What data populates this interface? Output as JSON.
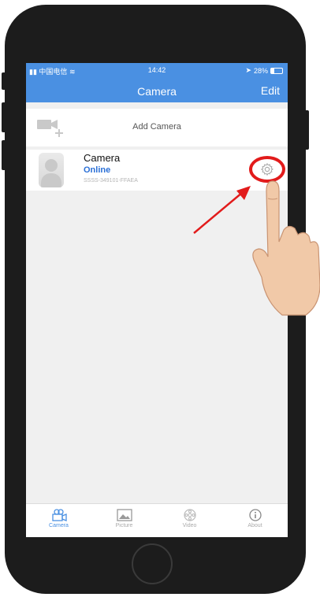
{
  "status_bar": {
    "carrier": "中国电信",
    "time": "14:42",
    "battery_text": "28%",
    "battery_level": 0.28
  },
  "navbar": {
    "title": "Camera",
    "edit_label": "Edit"
  },
  "add_camera": {
    "label": "Add Camera",
    "icon": "camera-add-icon"
  },
  "camera_item": {
    "name": "Camera",
    "status": "Online",
    "id": "SSSS-349101-FFAEA",
    "settings_icon": "gear-icon"
  },
  "tabs": [
    {
      "label": "Camera",
      "icon": "camera-tab-icon",
      "active": true
    },
    {
      "label": "Picture",
      "icon": "picture-icon",
      "active": false
    },
    {
      "label": "Video",
      "icon": "video-icon",
      "active": false
    },
    {
      "label": "About",
      "icon": "info-icon",
      "active": false
    }
  ],
  "colors": {
    "accent": "#4a90e2",
    "online": "#2a6fd6",
    "highlight": "#e21b1b"
  }
}
